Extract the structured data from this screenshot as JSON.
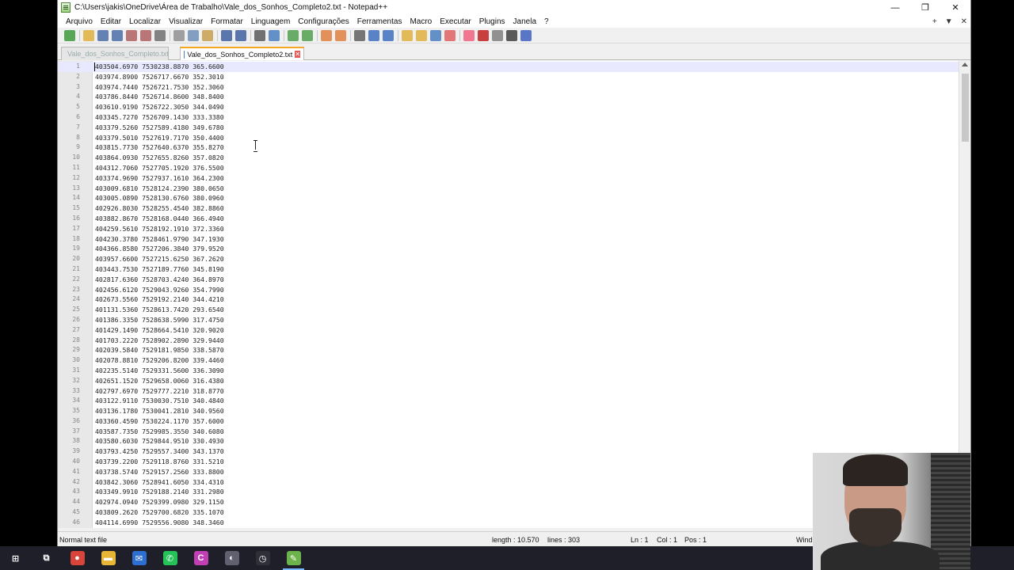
{
  "window": {
    "title": "C:\\Users\\jakis\\OneDrive\\Área de Trabalho\\Vale_dos_Sonhos_Completo2.txt - Notepad++",
    "minimize": "—",
    "restore": "❐",
    "close": "✕"
  },
  "menu": {
    "items": [
      "Arquivo",
      "Editar",
      "Localizar",
      "Visualizar",
      "Formatar",
      "Linguagem",
      "Configurações",
      "Ferramentas",
      "Macro",
      "Executar",
      "Plugins",
      "Janela",
      "?"
    ],
    "right": [
      "+",
      "▼",
      "✕"
    ]
  },
  "toolbar": {
    "icons": [
      "new-file-icon",
      "open-file-icon",
      "save-icon",
      "save-all-icon",
      "close-icon",
      "close-all-icon",
      "print-icon",
      "cut-icon",
      "copy-icon",
      "paste-icon",
      "undo-icon",
      "redo-icon",
      "find-icon",
      "replace-icon",
      "zoom-in-icon",
      "zoom-out-icon",
      "sync-v-icon",
      "sync-h-icon",
      "word-wrap-icon",
      "show-all-chars-icon",
      "indent-guide-icon",
      "doc-map-icon",
      "function-list-icon",
      "folder-workspace-icon",
      "monitor-icon",
      "record-macro-icon",
      "stop-macro-icon",
      "play-macro-icon",
      "run-macro-multiple-icon",
      "save-macro-icon"
    ],
    "colors": [
      "#3c9a3c",
      "#e0b040",
      "#4a6fa8",
      "#4a6fa8",
      "#b06060",
      "#b06060",
      "#707070",
      "#909090",
      "#6f8fb8",
      "#c8a050",
      "#4060a0",
      "#4060a0",
      "#5a5a5a",
      "#4a80c0",
      "#50a050",
      "#50a050",
      "#e08040",
      "#e08040",
      "#606060",
      "#4070c0",
      "#4070c0",
      "#e0b040",
      "#e0b040",
      "#4a80c0",
      "#e06060",
      "#f06080",
      "#c02020",
      "#808080",
      "#404040",
      "#4060c0"
    ]
  },
  "tabs": [
    {
      "label": "Vale_dos_Sonhos_Completo.txt",
      "active": false
    },
    {
      "label": "Vale_dos_Sonhos_Completo2.txt",
      "active": true
    }
  ],
  "editor": {
    "lines": [
      "403504.6970 7530238.8870 365.6600",
      "403974.8900 7526717.6670 352.3010",
      "403974.7440 7526721.7530 352.3060",
      "403786.8440 7526714.8600 348.8400",
      "403610.9190 7526722.3050 344.0490",
      "403345.7270 7526709.1430 333.3380",
      "403379.5260 7527589.4180 349.6780",
      "403379.5010 7527619.7170 350.4400",
      "403815.7730 7527640.6370 355.8270",
      "403864.0930 7527655.8260 357.0820",
      "404312.7060 7527705.1920 376.5500",
      "403374.9690 7527937.1610 364.2300",
      "403009.6810 7528124.2390 380.0650",
      "403005.0890 7528130.6760 380.0960",
      "402926.8030 7528255.4540 382.8860",
      "403882.8670 7528168.0440 366.4940",
      "404259.5610 7528192.1910 372.3360",
      "404230.3780 7528461.9790 347.1930",
      "404366.8580 7527206.3840 379.9520",
      "403957.6600 7527215.6250 367.2620",
      "403443.7530 7527189.7760 345.8190",
      "402817.6360 7528703.4240 364.8970",
      "402456.6120 7529043.9260 354.7990",
      "402673.5560 7529192.2140 344.4210",
      "401131.5360 7528613.7420 293.6540",
      "401386.3350 7528638.5990 317.4750",
      "401429.1490 7528664.5410 320.9020",
      "401703.2220 7528902.2890 329.9440",
      "402039.5840 7529181.9850 338.5870",
      "402078.8810 7529206.8200 339.4460",
      "402235.5140 7529331.5600 336.3090",
      "402651.1520 7529658.0060 316.4380",
      "402797.6970 7529777.2210 318.8770",
      "403122.9110 7530030.7510 340.4840",
      "403136.1780 7530041.2810 340.9560",
      "403360.4590 7530224.1170 357.6000",
      "403587.7350 7529985.3550 340.6080",
      "403580.6030 7529844.9510 330.4930",
      "403793.4250 7529557.3400 343.1370",
      "403739.2200 7529118.8760 331.5210",
      "403738.5740 7529157.2560 333.8800",
      "403842.3060 7528941.6050 334.4310",
      "403349.9910 7529188.2140 331.2980",
      "402974.0940 7529399.0980 329.1150",
      "403809.2620 7529700.6820 335.1070",
      "404114.6990 7529556.9080 348.3460"
    ]
  },
  "status": {
    "file_type": "Normal text file",
    "length": "length : 10.570",
    "lines": "lines : 303",
    "ln": "Ln : 1",
    "col": "Col : 1",
    "pos": "Pos : 1",
    "eol": "Wind"
  },
  "taskbar": {
    "icons": [
      {
        "name": "windows-start-icon",
        "glyph": "⊞",
        "color": "#1f1f2a"
      },
      {
        "name": "task-view-icon",
        "glyph": "⧉",
        "color": "#1f1f2a"
      },
      {
        "name": "chrome-icon",
        "glyph": "●",
        "color": "#d9453a"
      },
      {
        "name": "file-explorer-icon",
        "glyph": "▬",
        "color": "#e8b636"
      },
      {
        "name": "mail-icon",
        "glyph": "✉",
        "color": "#2d6fd1"
      },
      {
        "name": "whatsapp-icon",
        "glyph": "✆",
        "color": "#25c25a"
      },
      {
        "name": "canva-icon",
        "glyph": "C",
        "color": "#c03fb5"
      },
      {
        "name": "app-icon",
        "glyph": "◐",
        "color": "#606070"
      },
      {
        "name": "clock-app-icon",
        "glyph": "◷",
        "color": "#2f2f3a"
      },
      {
        "name": "notepadpp-icon",
        "glyph": "✎",
        "color": "#6bb34a"
      }
    ]
  }
}
